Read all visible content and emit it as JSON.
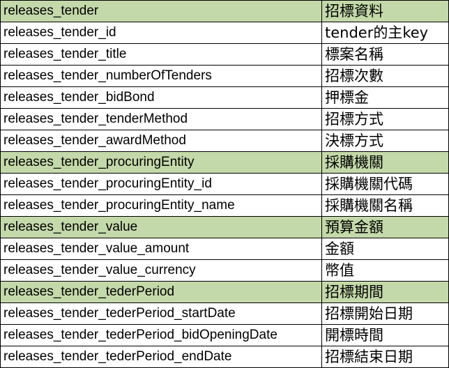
{
  "colors": {
    "group_header_background": "#c4d9a9",
    "cell_border": "#000000",
    "row_background": "#ffffff"
  },
  "rows": [
    {
      "key": "releases_tender",
      "desc": "招標資料",
      "group_header": true
    },
    {
      "key": "releases_tender_id",
      "desc": "tender的主key",
      "group_header": false
    },
    {
      "key": "releases_tender_title",
      "desc": "標案名稱",
      "group_header": false
    },
    {
      "key": "releases_tender_numberOfTenders",
      "desc": "招標次數",
      "group_header": false
    },
    {
      "key": "releases_tender_bidBond",
      "desc": "押標金",
      "group_header": false
    },
    {
      "key": "releases_tender_tenderMethod",
      "desc": "招標方式",
      "group_header": false
    },
    {
      "key": "releases_tender_awardMethod",
      "desc": "決標方式",
      "group_header": false
    },
    {
      "key": "releases_tender_procuringEntity",
      "desc": "採購機關",
      "group_header": true
    },
    {
      "key": "releases_tender_procuringEntity_id",
      "desc": "採購機關代碼",
      "group_header": false
    },
    {
      "key": "releases_tender_procuringEntity_name",
      "desc": "採購機關名稱",
      "group_header": false
    },
    {
      "key": "releases_tender_value",
      "desc": "預算金額",
      "group_header": true
    },
    {
      "key": "releases_tender_value_amount",
      "desc": "金額",
      "group_header": false
    },
    {
      "key": "releases_tender_value_currency",
      "desc": "幣值",
      "group_header": false
    },
    {
      "key": "releases_tender_tederPeriod",
      "desc": "招標期間",
      "group_header": true
    },
    {
      "key": "releases_tender_tederPeriod_startDate",
      "desc": "招標開始日期",
      "group_header": false
    },
    {
      "key": "releases_tender_tederPeriod_bidOpeningDate",
      "desc": "開標時間",
      "group_header": false
    },
    {
      "key": "releases_tender_tederPeriod_endDate",
      "desc": "招標結束日期",
      "group_header": false
    }
  ]
}
